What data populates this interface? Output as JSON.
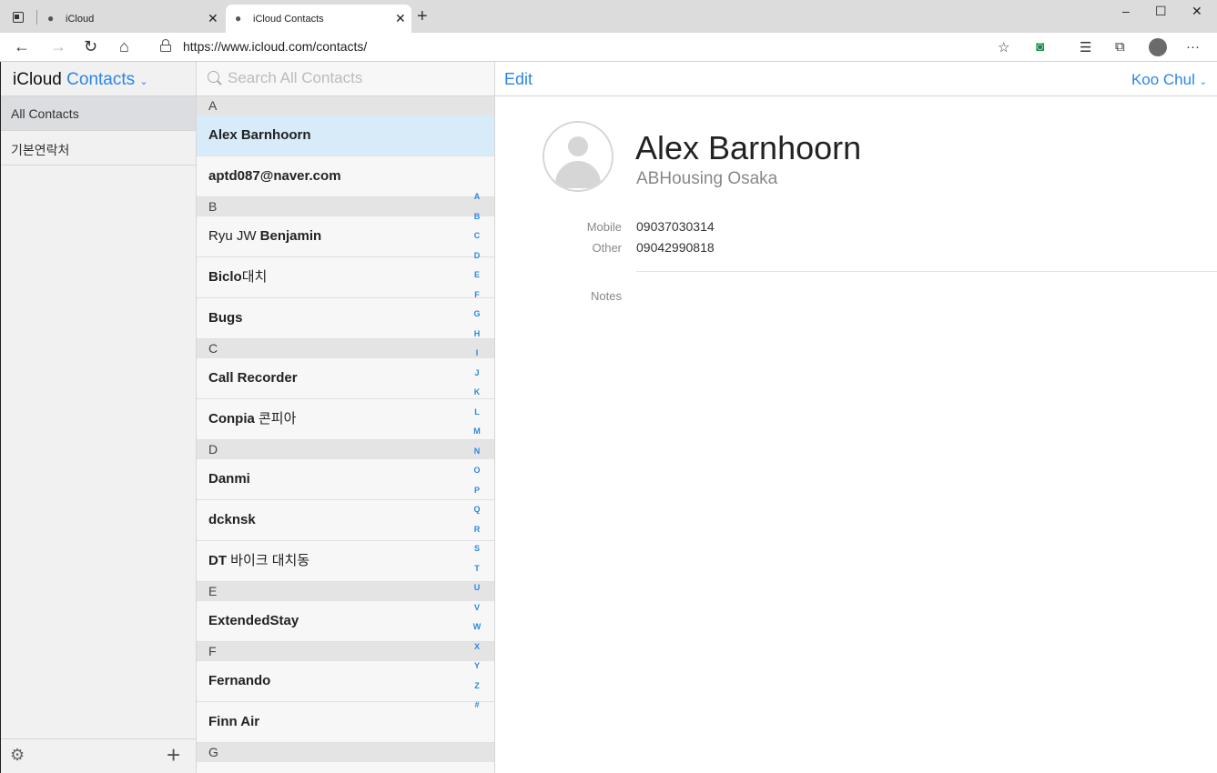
{
  "browser": {
    "tabs": [
      {
        "title": "iCloud",
        "close": "✕"
      },
      {
        "title": "iCloud Contacts",
        "close": "✕"
      }
    ],
    "new_tab": "+",
    "window_controls": {
      "minimize": "–",
      "maximize": "☐",
      "close": "✕"
    },
    "address": {
      "url": "https://www.icloud.com/contacts/"
    },
    "icons": [
      "back-icon",
      "forward-icon",
      "refresh-icon",
      "home-icon",
      "lock-icon",
      "favorite-add-icon",
      "extension-icon",
      "favorites-icon",
      "collections-icon",
      "profile-avatar-icon",
      "more-icon"
    ]
  },
  "sidebar": {
    "brand_prefix": "iCloud",
    "brand_app": "Contacts",
    "brand_chevron": "⌄",
    "groups": [
      {
        "label": "All Contacts"
      },
      {
        "label": "기본연락처"
      }
    ]
  },
  "list": {
    "search_placeholder": "Search All Contacts",
    "sections": [
      {
        "letter": "A",
        "contacts": [
          {
            "first": "",
            "last": "Alex Barnhoorn"
          },
          {
            "first": "",
            "last": "aptd087@naver.com"
          }
        ]
      },
      {
        "letter": "B",
        "contacts": [
          {
            "first": "Ryu JW ",
            "last": "Benjamin"
          },
          {
            "first": "",
            "last": "Biclo",
            "suffix": "대치"
          },
          {
            "first": "",
            "last": "Bugs"
          }
        ]
      },
      {
        "letter": "C",
        "contacts": [
          {
            "first": "",
            "last": "Call Recorder"
          },
          {
            "first": "",
            "last": "Conpia",
            "suffix": " 콘피아"
          }
        ]
      },
      {
        "letter": "D",
        "contacts": [
          {
            "first": "",
            "last": "Danmi"
          },
          {
            "first": "",
            "last": "dcknsk"
          },
          {
            "first": "",
            "last": "DT",
            "suffix": " 바이크 대치동"
          }
        ]
      },
      {
        "letter": "E",
        "contacts": [
          {
            "first": "",
            "last": "ExtendedStay"
          }
        ]
      },
      {
        "letter": "F",
        "contacts": [
          {
            "first": "",
            "last": "Fernando"
          },
          {
            "first": "",
            "last": "Finn Air"
          }
        ]
      },
      {
        "letter": "G",
        "contacts": []
      }
    ],
    "index_letters": [
      "A",
      "B",
      "C",
      "D",
      "E",
      "F",
      "G",
      "H",
      "I",
      "J",
      "K",
      "L",
      "M",
      "N",
      "O",
      "P",
      "Q",
      "R",
      "S",
      "T",
      "U",
      "V",
      "W",
      "X",
      "Y",
      "Z",
      "#"
    ]
  },
  "detail": {
    "edit_label": "Edit",
    "account_name": "Koo Chul",
    "account_chevron": "⌄",
    "name": "Alex Barnhoorn",
    "company": "ABHousing Osaka",
    "phones": [
      {
        "label": "Mobile",
        "value": "09037030314"
      },
      {
        "label": "Other",
        "value": "09042990818"
      }
    ],
    "notes_label": "Notes"
  },
  "colors": {
    "accent": "#2a86e6",
    "selected_row": "#d8ebf8",
    "sidebar_bg": "#f1f1f2"
  }
}
